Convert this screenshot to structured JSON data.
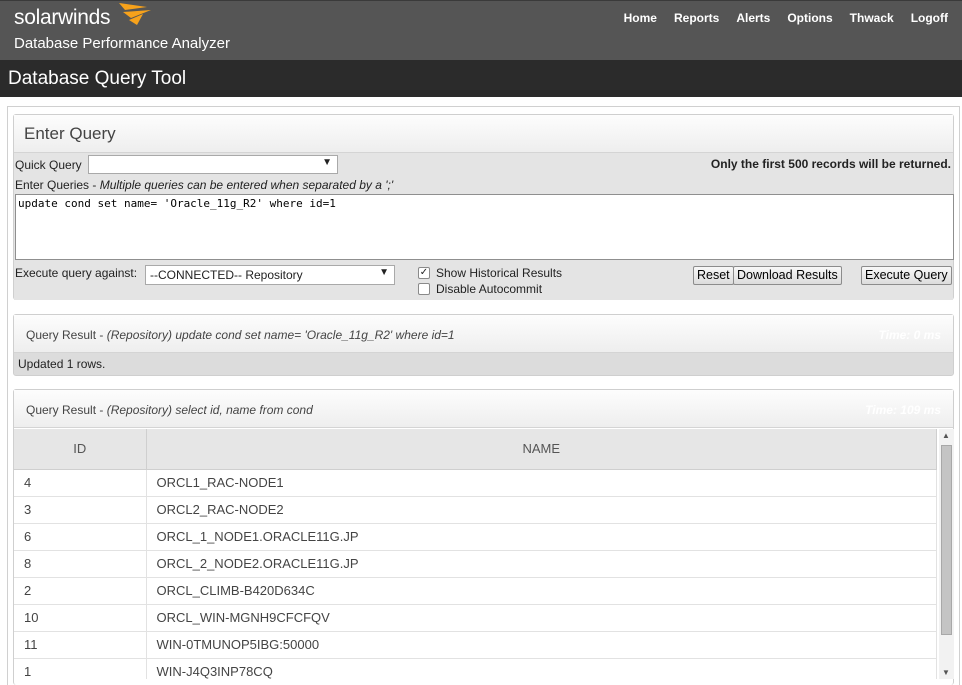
{
  "header": {
    "brand": "solarwinds",
    "product": "Database Performance Analyzer",
    "nav": [
      "Home",
      "Reports",
      "Alerts",
      "Options",
      "Thwack",
      "Logoff"
    ]
  },
  "page_title": "Database Query Tool",
  "enter_query": {
    "title": "Enter Query",
    "quick_query_label": "Quick Query",
    "quick_query_value": "",
    "notice": "Only the first 500 records will be returned.",
    "enter_queries_label": "Enter Queries - ",
    "enter_queries_hint": "Multiple queries can be entered when separated by a ';'",
    "query_text": "update cond set name= 'Oracle_11g_R2' where id=1",
    "execute_against_label": "Execute query against:",
    "execute_against_value": "--CONNECTED-- Repository",
    "show_historical_label": "Show Historical Results",
    "show_historical_checked": true,
    "disable_autocommit_label": "Disable Autocommit",
    "disable_autocommit_checked": false,
    "reset_label": "Reset",
    "download_label": "Download Results",
    "execute_label": "Execute Query"
  },
  "result1": {
    "prefix": "Query Result - ",
    "detail": "(Repository) update cond set name= 'Oracle_11g_R2' where id=1",
    "time": "Time: 0 ms",
    "message": "Updated 1 rows."
  },
  "result2": {
    "prefix": "Query Result - ",
    "detail": "(Repository) select id, name from cond",
    "time": "Time: 109 ms",
    "columns": [
      "ID",
      "NAME"
    ],
    "rows": [
      [
        "4",
        "ORCL1_RAC-NODE1"
      ],
      [
        "3",
        "ORCL2_RAC-NODE2"
      ],
      [
        "6",
        "ORCL_1_NODE1.ORACLE11G.JP"
      ],
      [
        "8",
        "ORCL_2_NODE2.ORACLE11G.JP"
      ],
      [
        "2",
        "ORCL_CLIMB-B420D634C"
      ],
      [
        "10",
        "ORCL_WIN-MGNH9CFCFQV"
      ],
      [
        "11",
        "WIN-0TMUNOP5IBG:50000"
      ],
      [
        "1",
        "WIN-J4Q3INP78CQ"
      ]
    ]
  },
  "colors": {
    "accent_orange": "#f7a21b",
    "header_bg": "#555555",
    "titlebar_bg": "#2b2b2b"
  }
}
